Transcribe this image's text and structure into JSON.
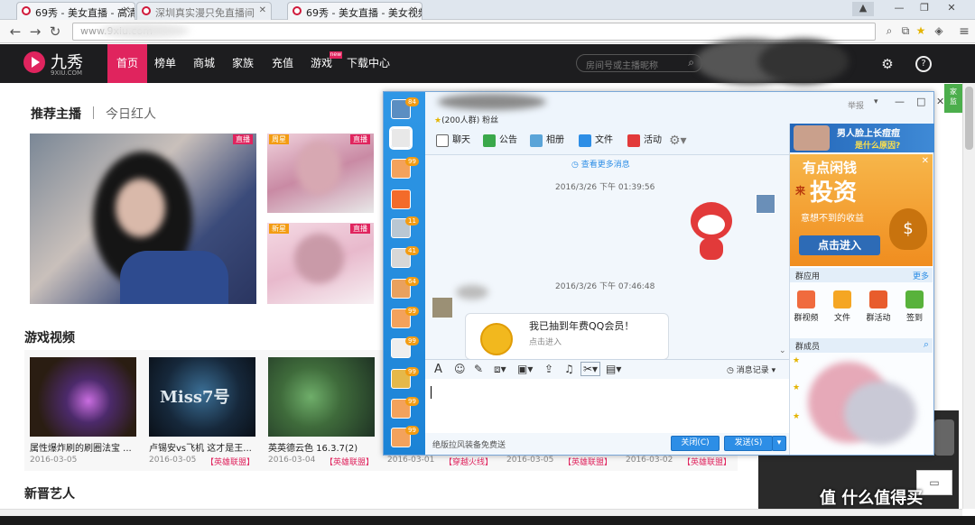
{
  "browser": {
    "tabs": [
      {
        "title": "69秀 - 美女直播 - 高清视频",
        "active": true
      },
      {
        "title": "深圳真实漫只免直播间",
        "active": false
      },
      {
        "title": "69秀 - 美女直播 - 美女视频",
        "active": false
      }
    ],
    "url": "www.9xiu.com"
  },
  "site": {
    "logo_name": "九秀",
    "logo_sub": "9XIU.COM",
    "nav": [
      "首页",
      "榜单",
      "商城",
      "家族",
      "充值",
      "游戏",
      "下载中心"
    ],
    "nav_hot_badge": "new",
    "search_placeholder": "房间号或主播昵称"
  },
  "recommend": {
    "title": "推荐主播",
    "tab2": "今日红人",
    "badges": [
      "直播",
      "直播",
      "周星",
      "直播",
      "新星"
    ]
  },
  "games": {
    "title": "游戏视频",
    "videos": [
      {
        "title": "属性爆炸刷的刷圈法宝 ...",
        "date": "2016-03-05",
        "tag": ""
      },
      {
        "title": "卢锡安vs飞机 这才是王...",
        "date": "2016-03-05",
        "tag": "【英雄联盟】"
      },
      {
        "title": "英英德云色 16.3.7(2)",
        "date": "2016-03-04",
        "tag": "【英雄联盟】"
      }
    ],
    "more_row": [
      {
        "date": "2016-03-01",
        "tag": "【穿越火线】"
      },
      {
        "date": "2016-03-05",
        "tag": "【英雄联盟】"
      },
      {
        "date": "2016-03-02",
        "tag": "【英雄联盟】"
      }
    ],
    "thumb2_text": "Miss7号"
  },
  "newstars": {
    "title": "新晋艺人"
  },
  "qq": {
    "group_line": "(200人群) 粉丝",
    "report": "举报",
    "toolbar": [
      "聊天",
      "公告",
      "相册",
      "文件",
      "活动"
    ],
    "view_more": "查看更多消息",
    "msg1_time": "2016/3/26 下午 01:39:56",
    "msg2_time": "2016/3/26 下午 07:46:48",
    "card_title": "我已抽到年费QQ会员！",
    "card_sub": "点击进入",
    "history": "消息记录",
    "bottom_hint": "绝版拉风装备免费送",
    "close_btn": "关闭(C)",
    "send_btn": "发送(S)",
    "left_counts": [
      "84",
      "99",
      "11",
      "41",
      "64",
      "99",
      "99",
      "99",
      "99",
      "99"
    ],
    "ad1_title": "男人脸上长痘痘",
    "ad1_sub": "是什么原因?",
    "ad2_line1": "有点闲钱",
    "ad2_line2": "投资",
    "ad2_prefix": "来",
    "ad2_line3": "意想不到的收益",
    "ad2_btn": "点击进入",
    "apps_title": "群应用",
    "apps_more": "更多",
    "apps": [
      "群视频",
      "文件",
      "群活动",
      "签到"
    ],
    "members_title": "群成员"
  },
  "watermark": "值 什么值得买",
  "colors": {
    "brand": "#e0245e",
    "qq_blue": "#2d8ee6",
    "header": "#1d1d1f"
  }
}
